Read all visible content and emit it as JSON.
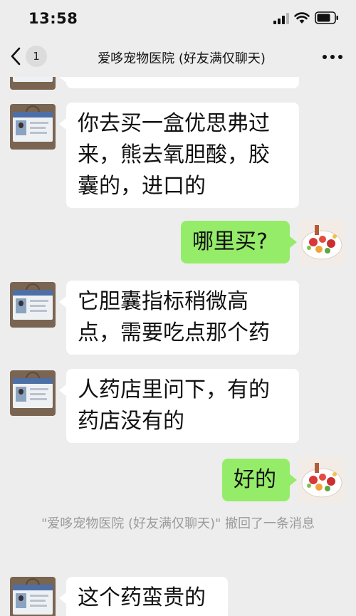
{
  "status_bar": {
    "time": "13:58",
    "icons": [
      "signal-icon",
      "wifi-icon",
      "battery-icon"
    ]
  },
  "nav": {
    "back_icon": "chevron-left-icon",
    "unread_count": "1",
    "title": "爱哆宠物医院 (好友满仅聊天)",
    "more_icon": "more-dots-icon"
  },
  "messages": [
    {
      "side": "left",
      "text": "你去买一盒优思弗过来，熊去氧胆酸，胶囊的，进口的"
    },
    {
      "side": "right",
      "text": "哪里买?"
    },
    {
      "side": "left",
      "text": "它胆囊指标稍微高点，需要吃点那个药"
    },
    {
      "side": "left",
      "text": "人药店里问下，有的药店没有的"
    },
    {
      "side": "right",
      "text": "好的"
    },
    {
      "side": "left",
      "text": "这个药蛮贵的"
    }
  ],
  "recall_notice": "\"爱哆宠物医院 (好友满仅聊天)\" 撤回了一条消息",
  "colors": {
    "background": "#ededed",
    "bubble_self": "#95ec69",
    "bubble_other": "#ffffff",
    "notice_text": "#9a9a9a"
  }
}
